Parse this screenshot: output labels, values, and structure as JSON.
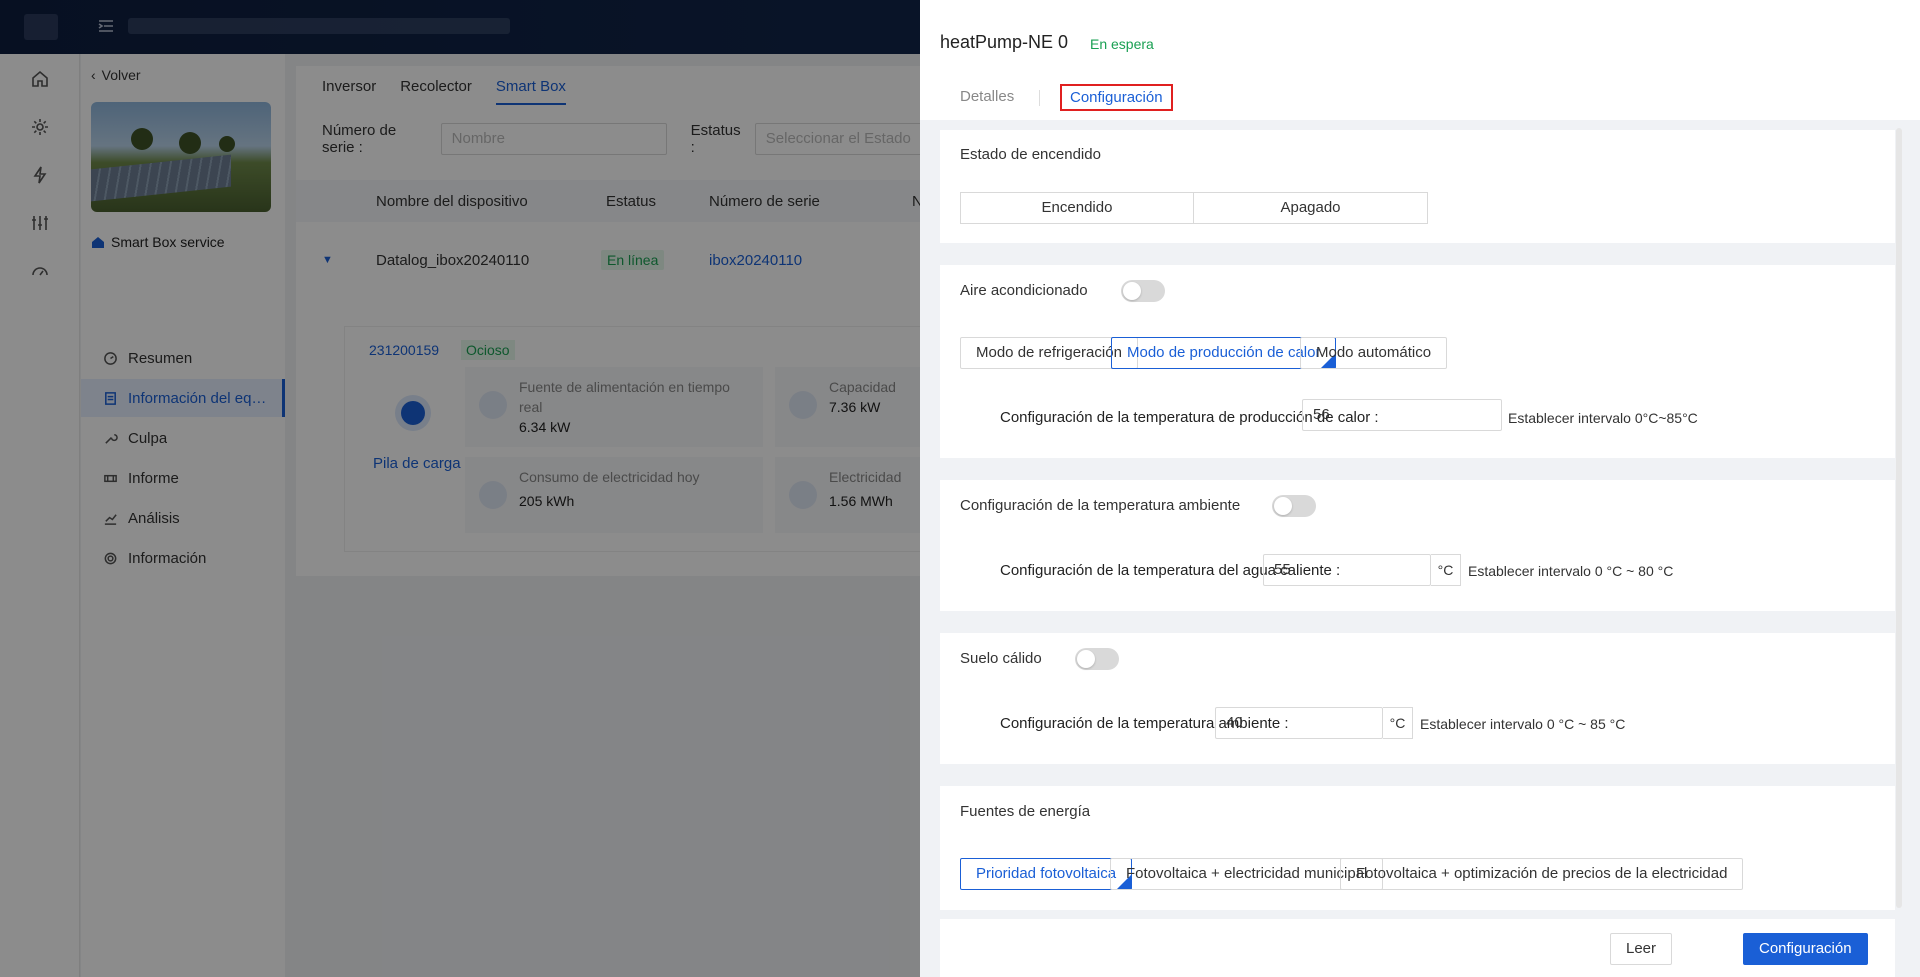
{
  "sidebar": {
    "back_label": "Volver",
    "service_name": "Smart Box service",
    "items": [
      {
        "label": "Resumen",
        "icon": "dashboard-icon"
      },
      {
        "label": "Información del eq…",
        "icon": "document-icon"
      },
      {
        "label": "Culpa",
        "icon": "wrench-icon"
      },
      {
        "label": "Informe",
        "icon": "report-icon"
      },
      {
        "label": "Análisis",
        "icon": "chart-icon"
      },
      {
        "label": "Información",
        "icon": "gear-icon"
      }
    ]
  },
  "main": {
    "tabs": [
      "Inversor",
      "Recolector",
      "Smart Box"
    ],
    "filters": {
      "serial_label": "Número de serie :",
      "serial_placeholder": "Nombre",
      "status_label": "Estatus :",
      "status_placeholder": "Seleccionar el Estado"
    },
    "table": {
      "headers": [
        "Nombre del dispositivo",
        "Estatus",
        "Número de serie",
        "N"
      ],
      "row": {
        "name": "Datalog_ibox20240110",
        "status": "En línea",
        "serial": "ibox20240110"
      }
    },
    "sub": {
      "serial": "231200159",
      "state": "Ocioso",
      "pile_label": "Pila de carga",
      "metrics": [
        {
          "title": "Fuente de alimentación en tiempo real",
          "value": "6.34 kW"
        },
        {
          "title": "Capacidad",
          "value": "7.36 kW"
        },
        {
          "title": "Consumo de electricidad hoy",
          "value": "205 kWh"
        },
        {
          "title": "Electricidad",
          "value": "1.56 MWh"
        }
      ]
    }
  },
  "drawer": {
    "title": "heatPump-NE 0",
    "status": "En espera",
    "tabs": {
      "details": "Detalles",
      "config": "Configuración"
    },
    "power": {
      "heading": "Estado de encendido",
      "on": "Encendido",
      "off": "Apagado"
    },
    "ac": {
      "heading": "Aire acondicionado",
      "modes": [
        "Modo de refrigeración",
        "Modo de producción de calor",
        "Modo automático"
      ],
      "selected_mode": "Modo de producción de calor",
      "field_label": "Configuración de la temperatura de producción de calor :",
      "field_value": "56",
      "hint": "Establecer intervalo 0°C~85°C"
    },
    "ambient": {
      "heading": "Configuración de la temperatura ambiente",
      "field_label": "Configuración de la temperatura del agua caliente :",
      "field_value": "55",
      "unit": "°C",
      "hint": "Establecer intervalo 0 °C ~ 80 °C"
    },
    "floor": {
      "heading": "Suelo cálido",
      "field_label": "Configuración de la temperatura ambiente :",
      "field_value": "40",
      "unit": "°C",
      "hint": "Establecer intervalo 0 °C ~ 85 °C"
    },
    "energy": {
      "heading": "Fuentes de energía",
      "options": [
        "Prioridad fotovoltaica",
        "Fotovoltaica + electricidad municipal",
        "Fotovoltaica + optimización de precios de la electricidad"
      ],
      "selected": "Prioridad fotovoltaica"
    },
    "footer": {
      "read": "Leer",
      "submit": "Configuración"
    }
  },
  "colors": {
    "accent": "#1a5fd6",
    "success": "#1aa053",
    "highlight": "#e02020"
  }
}
